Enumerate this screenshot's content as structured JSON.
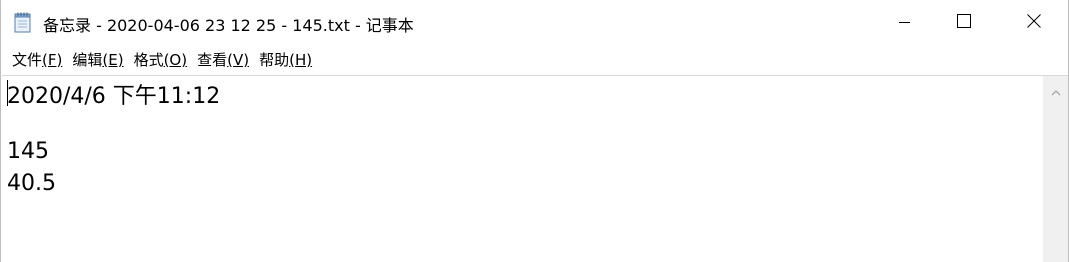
{
  "window": {
    "title": "备忘录 - 2020-04-06 23 12 25 - 145.txt - 记事本",
    "app_icon": "notepad-icon",
    "controls": {
      "minimize_icon": "minimize-icon",
      "maximize_icon": "maximize-icon",
      "close_icon": "close-icon"
    }
  },
  "menu": {
    "items": [
      {
        "label": "文件",
        "accel": "(F)"
      },
      {
        "label": "编辑",
        "accel": "(E)"
      },
      {
        "label": "格式",
        "accel": "(O)"
      },
      {
        "label": "查看",
        "accel": "(V)"
      },
      {
        "label": "帮助",
        "accel": "(H)"
      }
    ]
  },
  "editor": {
    "lines": [
      "2020/4/6 下午11:12",
      "",
      "145",
      "40.5"
    ]
  },
  "scrollbar": {
    "up_icon": "chevron-up-icon"
  }
}
